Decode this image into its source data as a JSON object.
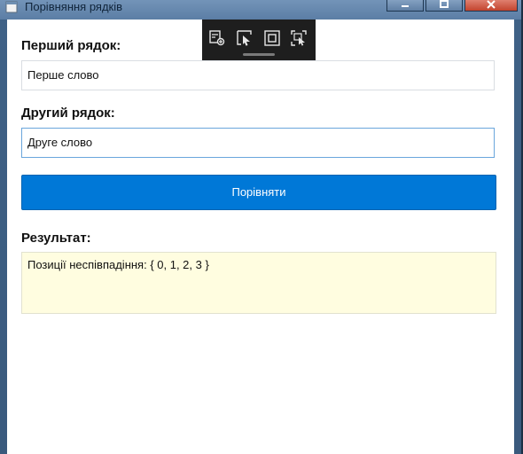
{
  "window": {
    "title": "Порівняння рядків"
  },
  "form": {
    "first_label": "Перший рядок:",
    "first_value": "Перше слово",
    "second_label": "Другий рядок:",
    "second_value": "Друге слово",
    "compare_button": "Порівняти",
    "result_label": "Результат:",
    "result_value": "Позиції неспівпадіння: { 0, 1, 2, 3 }"
  },
  "toolbar": {
    "icons": [
      "live-visual-tree-icon",
      "select-element-icon",
      "display-layout-adorners-icon",
      "track-focus-icon"
    ]
  },
  "colors": {
    "accent": "#0078d7",
    "result_background": "#fffde0",
    "toolbar_background": "#1e1e1e"
  }
}
